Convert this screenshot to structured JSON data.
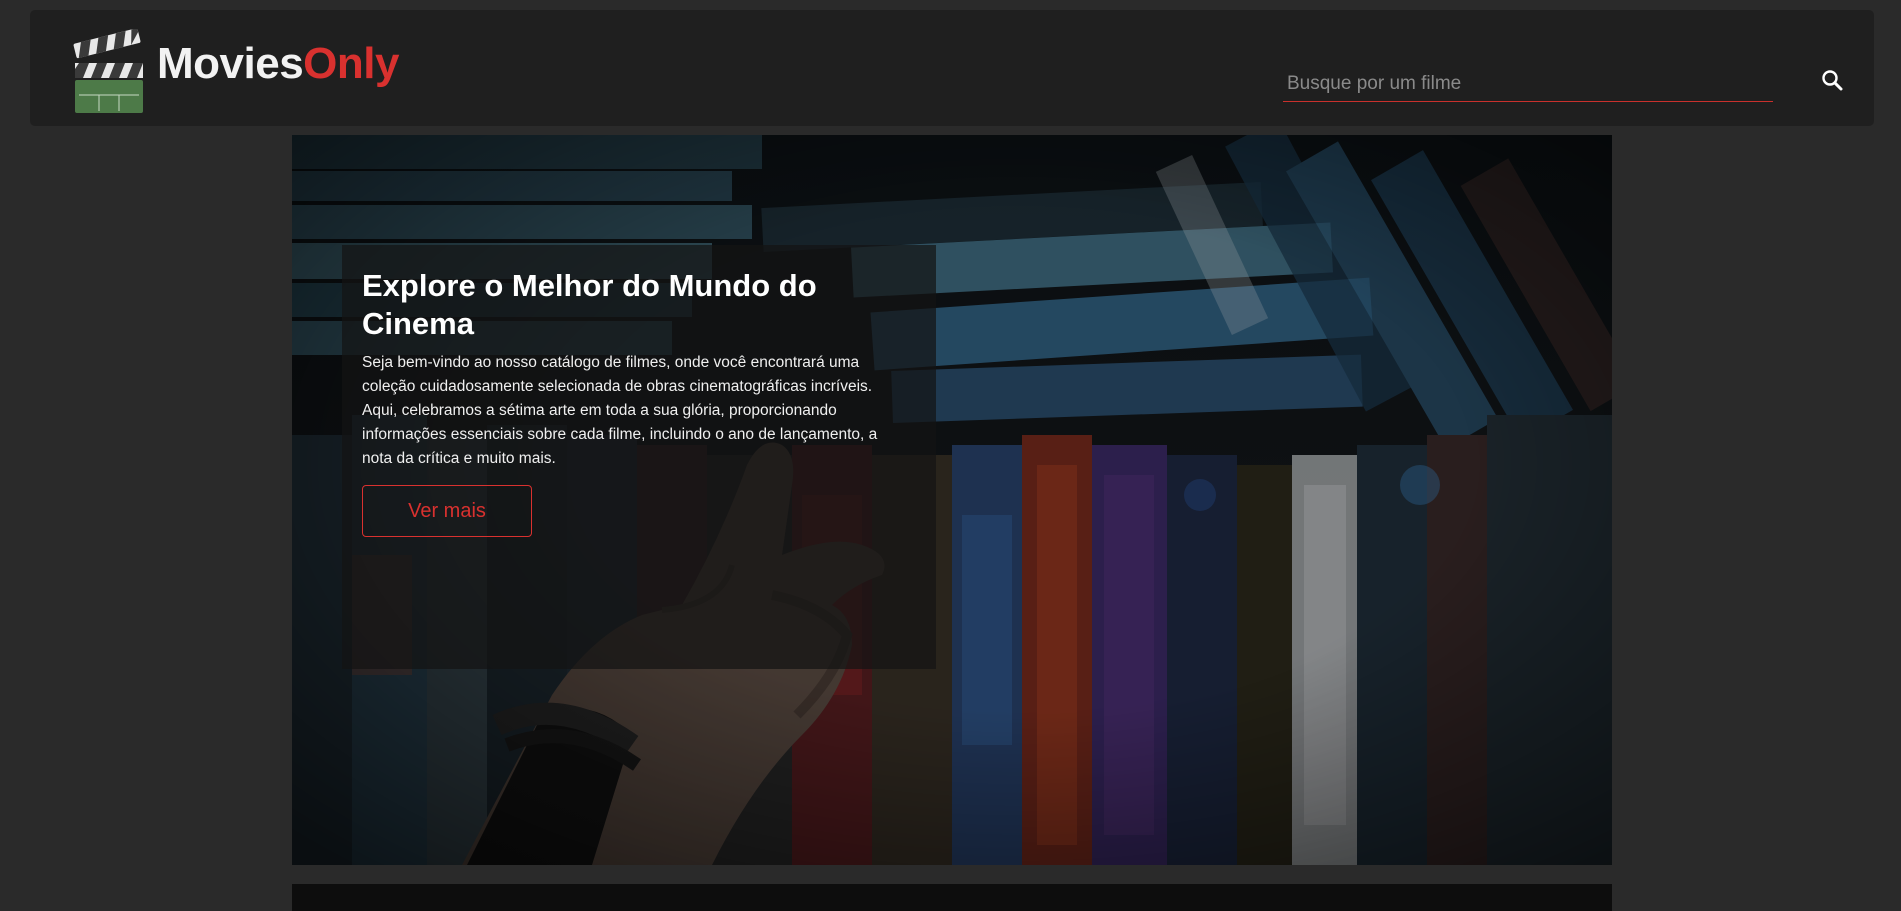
{
  "header": {
    "logo_text_part1": "Movies",
    "logo_text_part2": "Only",
    "search_placeholder": "Busque por um filme",
    "search_value": ""
  },
  "hero": {
    "title": "Explore o Melhor do Mundo do Cinema",
    "description": "Seja bem-vindo ao nosso catálogo de filmes, onde você encontrará uma coleção cuidadosamente selecionada de obras cinematográficas incríveis. Aqui, celebramos a sétima arte em toda a sua glória, proporcionando informações essenciais sobre cada filme, incluindo o ano de lançamento, a nota da crítica e muito mais.",
    "button_label": "Ver mais"
  },
  "colors": {
    "accent": "#d9312f",
    "page_background": "#2a2a2a",
    "header_background": "#1f1f1f"
  },
  "icons": {
    "logo": "clapperboard-icon",
    "search": "search-icon"
  }
}
